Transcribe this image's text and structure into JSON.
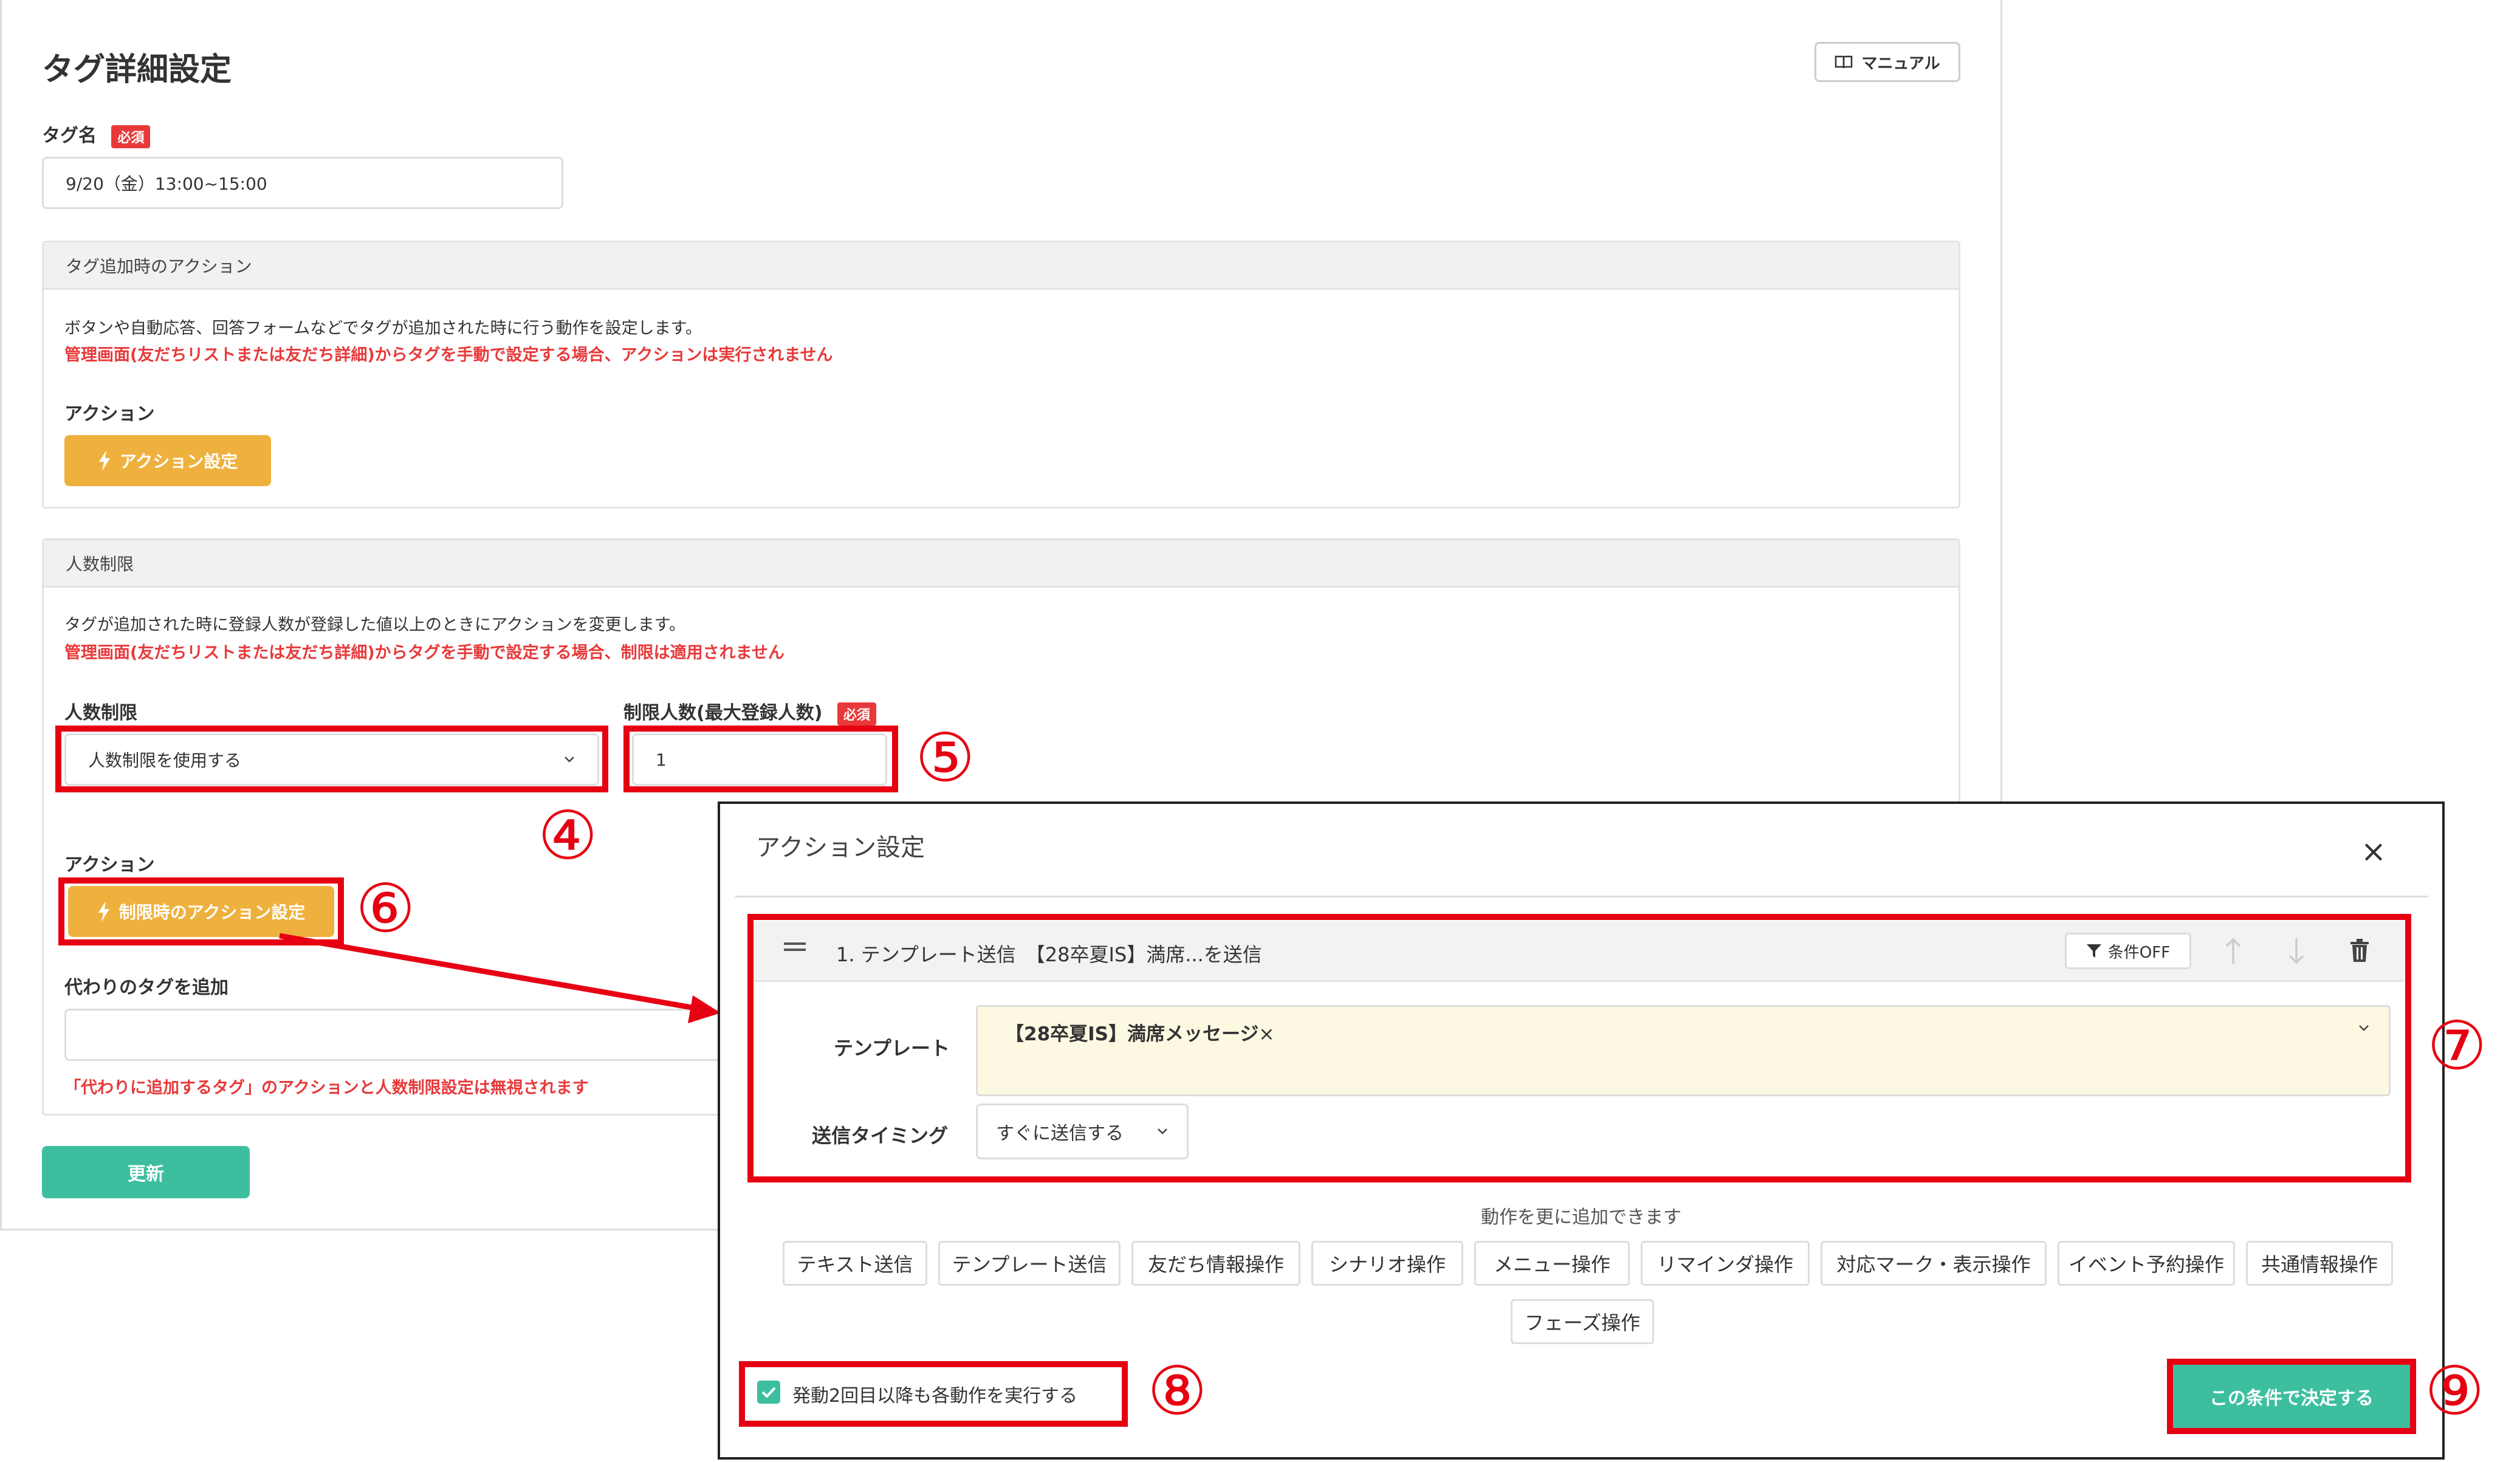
{
  "page": {
    "title": "タグ詳細設定",
    "manual_label": "マニュアル",
    "tag_name_label": "タグ名",
    "required_badge": "必須",
    "tag_name_value": "9/20（金）13:00~15:00",
    "update_label": "更新"
  },
  "add_action_section": {
    "header": "タグ追加時のアクション",
    "desc": "ボタンや自動応答、回答フォームなどでタグが追加された時に行う動作を設定します。",
    "warning": "管理画面(友だちリストまたは友だち詳細)からタグを手動で設定する場合、アクションは実行されません",
    "action_label": "アクション",
    "action_button": "アクション設定"
  },
  "limit_section": {
    "header": "人数制限",
    "desc": "タグが追加された時に登録人数が登録した値以上のときにアクションを変更します。",
    "warning": "管理画面(友だちリストまたは友だち詳細)からタグを手動で設定する場合、制限は適用されません",
    "limit_label": "人数制限",
    "limit_select_value": "人数制限を使用する",
    "max_label": "制限人数(最大登録人数)",
    "max_value": "1",
    "action_label": "アクション",
    "limit_action_button": "制限時のアクション設定",
    "alt_tag_label": "代わりのタグを追加",
    "alt_tag_value": "",
    "alt_tag_warning": "「代わりに追加するタグ」のアクションと人数制限設定は無視されます"
  },
  "annotations": {
    "n4": "④",
    "n5": "⑤",
    "n6": "⑥",
    "n7": "⑦",
    "n8": "⑧",
    "n9": "⑨"
  },
  "modal": {
    "title": "アクション設定",
    "close": "×",
    "step_title": "1. テンプレート送信　【28卒夏IS】満席...を送信",
    "condition_label": "条件OFF",
    "template_label": "テンプレート",
    "template_chip": "【28卒夏IS】満席メッセージ",
    "template_chip_remove": "×",
    "timing_label": "送信タイミング",
    "timing_value": "すぐに送信する",
    "add_more_text": "動作を更に追加できます",
    "action_types": [
      "テキスト送信",
      "テンプレート送信",
      "友だち情報操作",
      "シナリオ操作",
      "メニュー操作",
      "リマインダ操作",
      "対応マーク・表示操作",
      "イベント予約操作",
      "共通情報操作",
      "フェーズ操作"
    ],
    "repeat_checkbox_label": "発動2回目以降も各動作を実行する",
    "repeat_checked": true,
    "decide_button": "この条件で決定する"
  },
  "colors": {
    "accent_orange": "#efb13e",
    "accent_green": "#3dbf9f",
    "warning_red": "#e8393a",
    "annotation_red": "#e60012",
    "template_bg": "#fdf8e1"
  },
  "icons": {
    "manual": "book-icon",
    "action": "lightning-icon",
    "drag": "drag-handle-icon",
    "filter": "filter-icon",
    "up": "arrow-up-icon",
    "down": "arrow-down-icon",
    "delete": "trash-icon",
    "dropdown": "chevron-down-icon",
    "check": "checkbox-check-icon"
  }
}
